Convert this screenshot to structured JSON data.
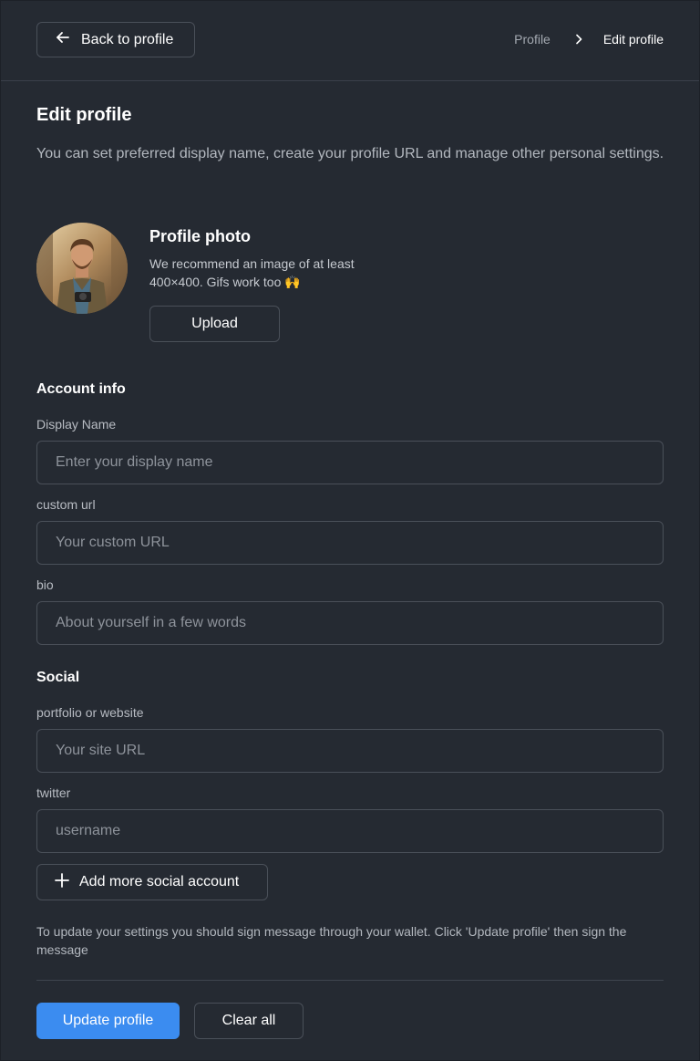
{
  "header": {
    "back_label": "Back to profile",
    "breadcrumb": {
      "parent": "Profile",
      "current": "Edit profile"
    }
  },
  "page": {
    "title": "Edit profile",
    "description": "You can set preferred display name, create your profile URL and manage other personal settings."
  },
  "photo": {
    "title": "Profile photo",
    "note": "We recommend an image of at least 400×400. Gifs work too 🙌",
    "upload_label": "Upload"
  },
  "account": {
    "title": "Account info",
    "display_name": {
      "label": "Display Name",
      "placeholder": "Enter your display name",
      "value": ""
    },
    "custom_url": {
      "label": "custom url",
      "placeholder": "Your custom URL",
      "value": ""
    },
    "bio": {
      "label": "bio",
      "placeholder": "About yourself in a few words",
      "value": ""
    }
  },
  "social": {
    "title": "Social",
    "website": {
      "label": "portfolio or website",
      "placeholder": "Your site URL",
      "value": ""
    },
    "twitter": {
      "label": "twitter",
      "placeholder": "username",
      "value": ""
    },
    "add_label": "Add more social account"
  },
  "footer": {
    "hint": "To update your settings you should sign message through your wallet. Click 'Update profile' then sign the message",
    "update_label": "Update profile",
    "clear_label": "Clear all"
  },
  "colors": {
    "background": "#252a32",
    "accent": "#3b8cf0",
    "border": "#4a5059"
  },
  "icons": {
    "back": "arrow-left-icon",
    "breadcrumb_separator": "chevron-right-icon",
    "add": "plus-icon"
  }
}
